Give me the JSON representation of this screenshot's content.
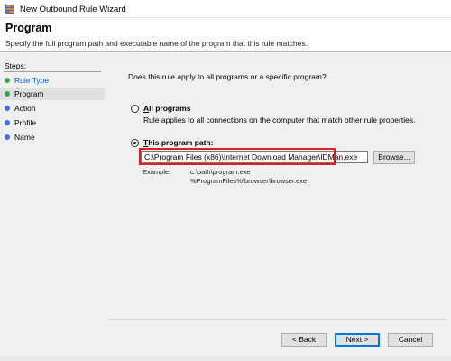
{
  "window": {
    "title": "New Outbound Rule Wizard"
  },
  "header": {
    "title": "Program",
    "subtitle": "Specify the full program path and executable name of the program that this rule matches."
  },
  "steps": {
    "heading": "Steps:",
    "items": [
      {
        "label": "Rule Type",
        "color": "#2fa84f",
        "link": true
      },
      {
        "label": "Program",
        "color": "#2fa84f",
        "current": true
      },
      {
        "label": "Action",
        "color": "#4a6fd8"
      },
      {
        "label": "Profile",
        "color": "#4a6fd8"
      },
      {
        "label": "Name",
        "color": "#4a6fd8"
      }
    ]
  },
  "main": {
    "question": "Does this rule apply to all programs or a specific program?",
    "all_programs": {
      "label_accel": "A",
      "label_rest": "ll programs",
      "description": "Rule applies to all connections on the computer that match other rule properties.",
      "selected": false
    },
    "this_program": {
      "label_accel": "T",
      "label_rest": "his program path:",
      "selected": true,
      "path_value": "C:\\Program Files (x86)\\Internet Download Manager\\IDMan.exe"
    },
    "browse_label": "Browse...",
    "example_label": "Example:",
    "example_lines": [
      "c:\\path\\program.exe",
      "%ProgramFiles%\\browser\\browser.exe"
    ]
  },
  "footer": {
    "back_label": "< Back",
    "next_label": "Next >",
    "cancel_label": "Cancel"
  },
  "colors": {
    "highlight": "#e31b23",
    "link": "#0066cc",
    "accent": "#0078d7"
  }
}
